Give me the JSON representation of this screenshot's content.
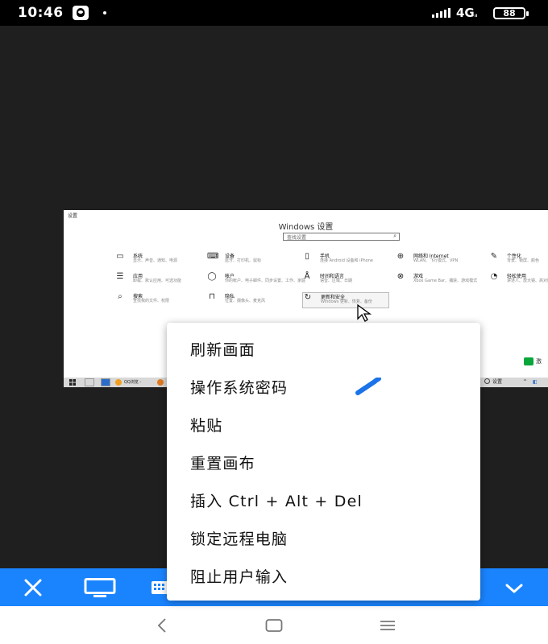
{
  "status_bar": {
    "time": "10:46",
    "network": "4G",
    "network_sub": "ᵢₗ",
    "battery": "88"
  },
  "remote": {
    "corner_label": "设置",
    "title": "Windows 设置",
    "search_placeholder": "查找设置",
    "tiles": [
      {
        "id": "system",
        "icon": "laptop-icon",
        "glyph": "▭",
        "title": "系统",
        "desc": "显示、声音、通知、电源"
      },
      {
        "id": "devices",
        "icon": "keyboard-icon",
        "glyph": "⌨",
        "title": "设备",
        "desc": "蓝牙、打印机、鼠标"
      },
      {
        "id": "phone",
        "icon": "phone-icon",
        "glyph": "▯",
        "title": "手机",
        "desc": "连接 Android 设备和 iPhone"
      },
      {
        "id": "network",
        "icon": "globe-icon",
        "glyph": "⊕",
        "title": "网络和 Internet",
        "desc": "WLAN、飞行模式、VPN"
      },
      {
        "id": "personalization",
        "icon": "brush-icon",
        "glyph": "✎",
        "title": "个性化",
        "desc": "背景、锁屏、颜色"
      },
      {
        "id": "apps",
        "icon": "apps-list-icon",
        "glyph": "☰",
        "title": "应用",
        "desc": "卸载、默认应用、可选功能"
      },
      {
        "id": "accounts",
        "icon": "person-icon",
        "glyph": "◯",
        "title": "帐户",
        "desc": "你的帐户、电子邮件、同步设置、工作、家庭"
      },
      {
        "id": "time",
        "icon": "clock-language-icon",
        "glyph": "Å",
        "title": "时间和语言",
        "desc": "语音、区域、日期"
      },
      {
        "id": "gaming",
        "icon": "xbox-icon",
        "glyph": "⊗",
        "title": "游戏",
        "desc": "Xbox Game Bar、捕获、游戏模式"
      },
      {
        "id": "ease",
        "icon": "ease-of-access-icon",
        "glyph": "◔",
        "title": "轻松使用",
        "desc": "讲述人、放大镜、高对比度"
      },
      {
        "id": "search",
        "icon": "search-icon",
        "glyph": "⌕",
        "title": "搜索",
        "desc": "查找我的文件、权限"
      },
      {
        "id": "privacy",
        "icon": "lock-icon",
        "glyph": "⊓",
        "title": "隐私",
        "desc": "位置、摄像头、麦克风"
      },
      {
        "id": "update",
        "icon": "sync-icon",
        "glyph": "↻",
        "title": "更新和安全",
        "desc": "Windows 更新、恢复、备份"
      }
    ],
    "activate_text": "激",
    "taskbar": {
      "apps": [
        {
          "label": "QQ浏览 -",
          "color": "#f0a020"
        },
        {
          "label": "",
          "color": "#e07b20"
        }
      ],
      "right_label": "设置"
    }
  },
  "context_menu": {
    "items": [
      {
        "id": "refresh",
        "label": "刷新画面"
      },
      {
        "id": "os-password",
        "label": "操作系统密码"
      },
      {
        "id": "paste",
        "label": "粘贴"
      },
      {
        "id": "reset-canvas",
        "label": "重置画布"
      },
      {
        "id": "ctrl-alt-del",
        "label": "插入 Ctrl + Alt + Del"
      },
      {
        "id": "lock-remote",
        "label": "锁定远程电脑"
      },
      {
        "id": "block-input",
        "label": "阻止用户输入"
      }
    ]
  },
  "toolbar": {
    "close_icon": "close-icon",
    "display_icon": "monitor-icon",
    "keyboard_icon": "keyboard-icon",
    "collapse_icon": "chevron-down-icon"
  },
  "colors": {
    "toolbar": "#1a84ff",
    "pencil": "#1a73e8",
    "background": "#1f1f1f"
  }
}
